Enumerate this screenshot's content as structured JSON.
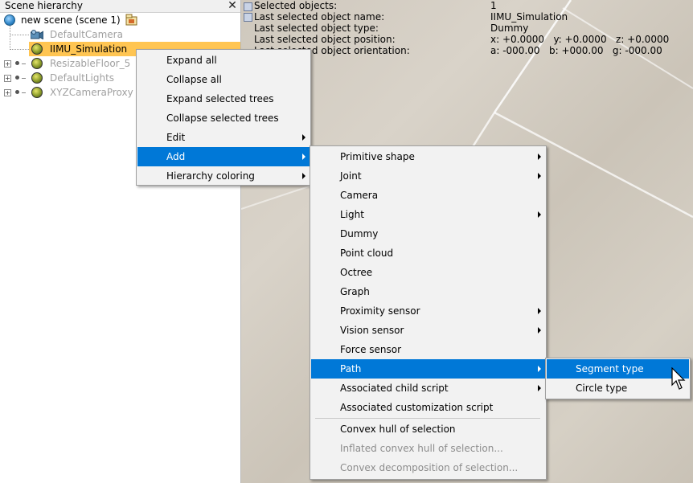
{
  "hierarchy": {
    "title": "Scene hierarchy",
    "close_glyph": "✕",
    "root": "new scene (scene 1)",
    "items": [
      {
        "label": "DefaultCamera",
        "icon": "camera-icon",
        "dim": true
      },
      {
        "label": "IIMU_Simulation",
        "icon": "dummy-icon",
        "selected": true
      },
      {
        "label": "ResizableFloor_5",
        "icon": "shape-icon",
        "dim": true
      },
      {
        "label": "DefaultLights",
        "icon": "shape-icon",
        "dim": true
      },
      {
        "label": "XYZCameraProxy",
        "icon": "shape-icon",
        "dim": true
      }
    ]
  },
  "info": {
    "rows": [
      {
        "label": "Selected objects:",
        "value": "1"
      },
      {
        "label": "Last selected object name:",
        "value": "IIMU_Simulation"
      },
      {
        "label": "Last selected object type:",
        "value": "Dummy"
      },
      {
        "label": "Last selected object position:",
        "value": "x: +0.0000   y: +0.0000   z: +0.0000"
      },
      {
        "label": "Last selected object orientation:",
        "value": "a: -000.00   b: +000.00   g: -000.00"
      }
    ]
  },
  "context_menu": {
    "items": [
      {
        "label": "Expand all"
      },
      {
        "label": "Collapse all"
      },
      {
        "label": "Expand selected trees"
      },
      {
        "label": "Collapse selected trees"
      },
      {
        "label": "Edit",
        "submenu": true
      },
      {
        "label": "Add",
        "submenu": true,
        "highlighted": true
      },
      {
        "label": "Hierarchy coloring",
        "submenu": true
      }
    ]
  },
  "add_menu": {
    "items": [
      {
        "label": "Primitive shape",
        "submenu": true
      },
      {
        "label": "Joint",
        "submenu": true
      },
      {
        "label": "Camera"
      },
      {
        "label": "Light",
        "submenu": true
      },
      {
        "label": "Dummy"
      },
      {
        "label": "Point cloud"
      },
      {
        "label": "Octree"
      },
      {
        "label": "Graph"
      },
      {
        "label": "Proximity sensor",
        "submenu": true
      },
      {
        "label": "Vision sensor",
        "submenu": true
      },
      {
        "label": "Force sensor"
      },
      {
        "label": "Path",
        "submenu": true,
        "highlighted": true
      },
      {
        "label": "Associated child script",
        "submenu": true
      },
      {
        "label": "Associated customization script"
      },
      {
        "label": "Convex hull of selection"
      },
      {
        "label": "Inflated convex hull of selection...",
        "disabled": true
      },
      {
        "label": "Convex decomposition of selection...",
        "disabled": true
      }
    ]
  },
  "path_menu": {
    "items": [
      {
        "label": "Segment type",
        "highlighted": true
      },
      {
        "label": "Circle type"
      }
    ]
  },
  "colors": {
    "highlight": "#0078d7",
    "selected_row": "#ffc552"
  }
}
